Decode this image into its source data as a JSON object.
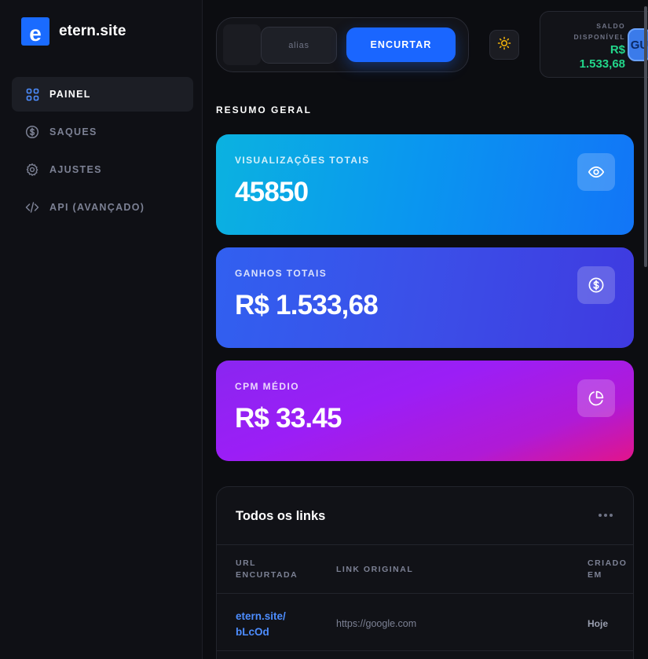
{
  "brand": {
    "logo_letter": "e",
    "name": "etern.site"
  },
  "nav": {
    "items": [
      {
        "label": "PAINEL",
        "icon": "grid-icon",
        "active": true
      },
      {
        "label": "SAQUES",
        "icon": "dollar-circle-icon",
        "active": false
      },
      {
        "label": "AJUSTES",
        "icon": "gear-icon",
        "active": false
      },
      {
        "label": "API (AVANÇADO)",
        "icon": "code-icon",
        "active": false
      }
    ]
  },
  "shortener": {
    "alias_placeholder": "alias",
    "button_label": "ENCURTAR"
  },
  "balance": {
    "label_line1": "SALDO",
    "label_line2": "DISPONÍVEL",
    "currency": "R$",
    "value": "1.533,68"
  },
  "avatar": {
    "initials": "GU"
  },
  "summary": {
    "title": "RESUMO GERAL",
    "cards": [
      {
        "label": "VISUALIZAÇÕES TOTAIS",
        "value": "45850",
        "icon": "eye-icon"
      },
      {
        "label": "GANHOS TOTAIS",
        "value": "R$ 1.533,68",
        "icon": "dollar-circle-icon"
      },
      {
        "label": "CPM MÉDIO",
        "value": "R$ 33.45",
        "icon": "pie-chart-icon"
      }
    ]
  },
  "links": {
    "title": "Todos os links",
    "columns": {
      "short_l1": "URL",
      "short_l2": "ENCURTADA",
      "original": "LINK ORIGINAL",
      "created_l1": "CRIADO",
      "created_l2": "EM"
    },
    "rows": [
      {
        "short_l1": "etern.site/",
        "short_l2": "bLcOd",
        "original": "https://google.com",
        "created": "Hoje"
      }
    ]
  },
  "colors": {
    "accent": "#1a66ff",
    "balance_green": "#22d68a",
    "link_blue": "#4d8dff"
  }
}
